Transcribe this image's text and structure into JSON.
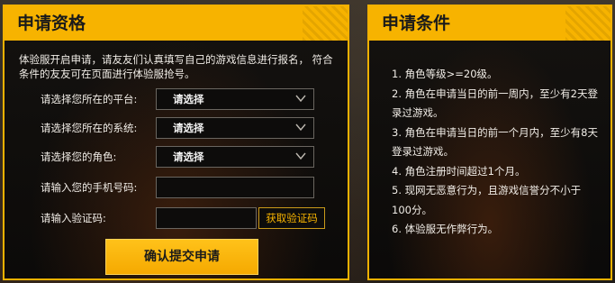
{
  "application_panel": {
    "title": "申请资格",
    "intro": "体验服开启申请，请友友们认真填写自己的游戏信息进行报名， 符合条件的友友可在页面进行体验服抢号。",
    "platform": {
      "label": "请选择您所在的平台:",
      "value": "请选择"
    },
    "system": {
      "label": "请选择您所在的系统:",
      "value": "请选择"
    },
    "role": {
      "label": "请选择您的角色:",
      "value": "请选择"
    },
    "phone": {
      "label": "请输入您的手机号码:",
      "value": ""
    },
    "code": {
      "label": "请输入验证码:",
      "value": "",
      "button": "获取验证码"
    },
    "submit": "确认提交申请"
  },
  "conditions_panel": {
    "title": "申请条件",
    "items": [
      "1. 角色等级>=20级。",
      "2. 角色在申请当日的前一周内，至少有2天登录过游戏。",
      "3. 角色在申请当日的前一个月内，至少有8天登录过游戏。",
      "4. 角色注册时间超过1个月。",
      "5. 现网无恶意行为，且游戏信誉分不小于100分。",
      "6. 体验服无作弊行为。"
    ]
  },
  "colors": {
    "accent": "#f7b300",
    "panel_bg": "#0f0e0c",
    "text": "#f0ece6"
  }
}
